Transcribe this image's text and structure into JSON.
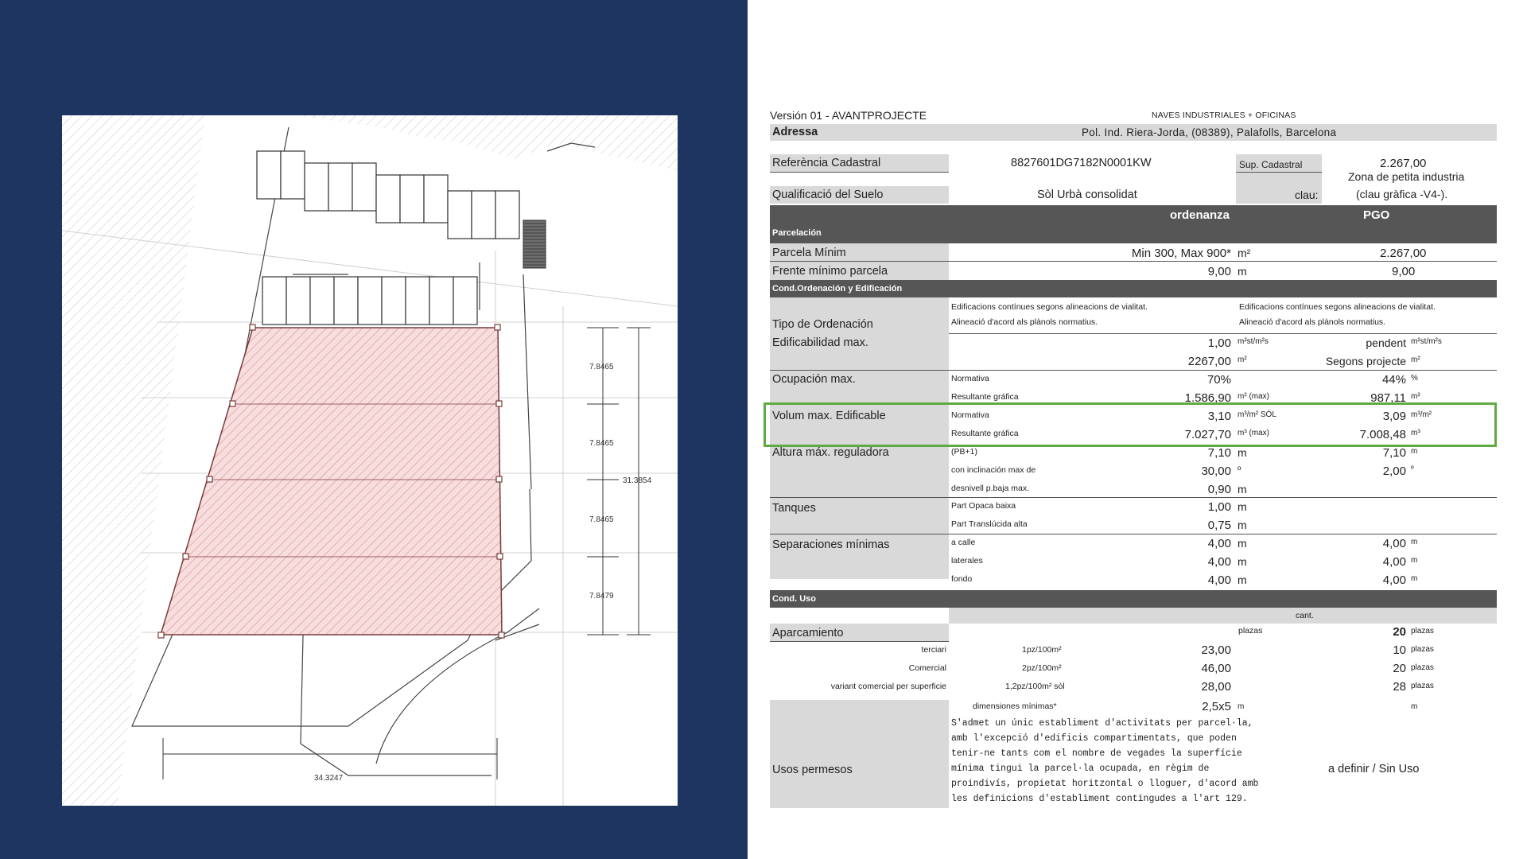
{
  "header": {
    "version": "Versión 01 - AVANTPROJECTE",
    "project": "NAVES INDUSTRIALES + OFICINAS",
    "address_label": "Adressa",
    "address_value": "Pol. Ind. Riera-Jorda, (08389), Palafolls, Barcelona"
  },
  "cadastral": {
    "ref_label": "Referència Cadastral",
    "ref_value": "8827601DG7182N0001KW",
    "sup_label": "Sup. Cadastral",
    "sup_value": "2.267,00",
    "qual_label": "Qualificació del Suelo",
    "qual_value": "Sòl Urbà consolidat",
    "clau_label": "clau:",
    "zona_line1": "Zona de petita industria",
    "zona_line2": "(clau gràfica -V4-)."
  },
  "columns": {
    "ordenanza": "ordenanza",
    "pgo": "PGO"
  },
  "sections": {
    "parcelacion": "Parcelación",
    "cond_ordenacion": "Cond.Ordenación  y Edificación",
    "cond_uso": "Cond.  Uso"
  },
  "parcela": {
    "label": "Parcela Mínim",
    "ord": "Min 300, Max 900*",
    "unit": "m²",
    "pgo": "2.267,00"
  },
  "frente": {
    "label": "Frente mínimo parcela",
    "ord": "9,00",
    "unit": "m",
    "pgo": "9,00"
  },
  "tipo": {
    "label": "Tipo de Ordenación",
    "ord_l1": "Edificacions contínues segons alineacions de vialitat.",
    "ord_l2": "Alineació d'acord als plànols normatius.",
    "pgo_l1": "Edificacions contínues segons alineacions de vialitat.",
    "pgo_l2": "Alineació d'acord als plànols normatius."
  },
  "edificabilidad": {
    "label": "Edificabilidad max.",
    "v1": "1,00",
    "u1": "m²st/m²s",
    "p1": "pendent",
    "pu1": "m²st/m²s",
    "v2": "2267,00",
    "u2": "m²",
    "p2": "Segons projecte",
    "pu2": "m²"
  },
  "ocupacion": {
    "label": "Ocupación max.",
    "s1": "Normativa",
    "v1": "70%",
    "p1": "44%",
    "pu1": "%",
    "s2": "Resultante gráfica",
    "v2": "1.586,90",
    "u2": "m² (max)",
    "p2": "987,11",
    "pu2": "m²"
  },
  "volum": {
    "label": "Volum max. Edificable",
    "s1": "Normativa",
    "v1": "3,10",
    "u1": "m³/m² SÒL",
    "p1": "3,09",
    "pu1": "m³/m²",
    "s2": "Resultante gráfica",
    "v2": "7.027,70",
    "u2": "m³ (max)",
    "p2": "7.008,48",
    "pu2": "m³"
  },
  "altura": {
    "label": "Altura máx. reguladora",
    "s1": "(PB+1)",
    "v1": "7,10",
    "u1": "m",
    "p1": "7,10",
    "pu1": "m",
    "s2": "con  inclinación max de",
    "v2": "30,00",
    "u2": "º",
    "p2": "2,00",
    "pu2": "º",
    "s3": "desnivell p.baja max.",
    "v3": "0,90",
    "u3": "m"
  },
  "tanques": {
    "label": "Tanques",
    "s1": "Part Opaca baixa",
    "v1": "1,00",
    "u1": "m",
    "s2": "Part Translúcida alta",
    "v2": "0,75",
    "u2": "m"
  },
  "separaciones": {
    "label": "Separaciones mínimas",
    "s1": "a calle",
    "v1": "4,00",
    "u1": "m",
    "p1": "4,00",
    "pu1": "m",
    "s2": "laterales",
    "v2": "4,00",
    "u2": "m",
    "p2": "4,00",
    "pu2": "m",
    "s3": "fondo",
    "v3": "4,00",
    "u3": "m",
    "p3": "4,00",
    "pu3": "m"
  },
  "uso": {
    "cant": "cant.",
    "apar_label": "Aparcamiento",
    "plazas_label": "plazas",
    "apar_total": "20",
    "apar_unit": "plazas",
    "rows": [
      {
        "name": "terciari",
        "ratio": "1pz/100m²",
        "value": "23,00",
        "count": "10",
        "unit": "plazas"
      },
      {
        "name": "Comercial",
        "ratio": "2pz/100m²",
        "value": "46,00",
        "count": "20",
        "unit": "plazas"
      },
      {
        "name": "variant comercial per superficie",
        "ratio": "1,2pz/100m² sòl",
        "value": "28,00",
        "count": "28",
        "unit": "plazas"
      }
    ],
    "dim_label": "dimensiones mínimas*",
    "dim_value": "2,5x5",
    "dim_unit": "m",
    "dim_unit2": "m",
    "usos_label": "Usos permesos",
    "usos_text": [
      "S'admet un únic establiment d'activitats per parcel·la,",
      "amb l'excepció d'edificis compartimentats, que poden",
      "tenir-ne tants com el nombre de vegades la superfície",
      "mínima tingui la parcel·la ocupada, en règim de",
      "proindivís, propietat horitzontal o lloguer, d'acord amb",
      "les definicions d'establiment contingudes a l'art 129."
    ],
    "usos_pgo": "a definir /  Sin Uso"
  },
  "plan": {
    "dims": [
      "7.8465",
      "7.8465",
      "7.8465",
      "7.8479"
    ],
    "total": "31.3854",
    "width": "34.3247"
  },
  "colors": {
    "panel": "#1f3561",
    "highlight": "#5eaa44",
    "hatch": "#e89a9a",
    "grey": "#d9d9d9",
    "dark": "#565656"
  }
}
